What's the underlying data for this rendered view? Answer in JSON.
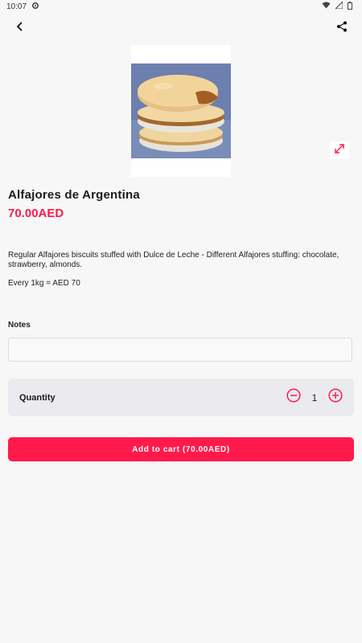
{
  "status_bar": {
    "time": "10:07",
    "icons": [
      "settings-icon",
      "wifi-icon",
      "signal-icon",
      "battery-icon"
    ]
  },
  "app_bar": {
    "back_icon": "back-arrow-icon",
    "share_icon": "share-icon"
  },
  "product": {
    "title": "Alfajores de Argentina",
    "price": "70.00AED",
    "description": "Regular Alfajores biscuits stuffed with Dulce de Leche - Different Alfajores stuffing: chocolate, strawberry, almonds.",
    "note": "Every 1kg = AED 70",
    "image_icon": "alfajores-cookie-image"
  },
  "notes": {
    "label": "Notes",
    "value": "",
    "placeholder": ""
  },
  "quantity": {
    "label": "Quantity",
    "value": "1"
  },
  "cart": {
    "button_label": "Add to cart (70.00AED)"
  },
  "colors": {
    "accent": "#ff1a4b",
    "background": "#f7f7f7",
    "card": "#ebebef"
  }
}
